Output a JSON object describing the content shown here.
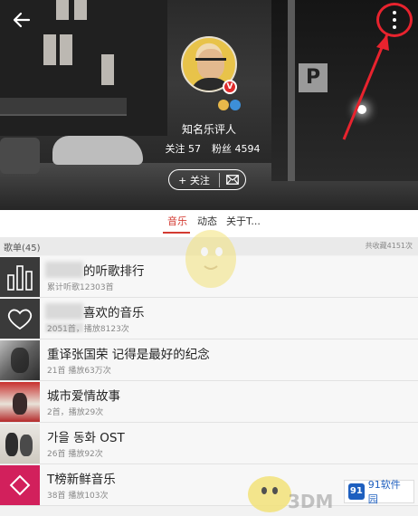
{
  "colors": {
    "accent": "#d33a31",
    "highlight": "#e8232e"
  },
  "header": {
    "back_icon": "arrow-left-icon",
    "more_icon": "more-vertical-icon",
    "profile_title": "知名乐评人",
    "stats": {
      "follow": "关注 57",
      "fans": "粉丝 4594"
    },
    "follow_label": "+ 关注",
    "message_icon": "mail-icon",
    "verified_badge": "V"
  },
  "tabs": [
    {
      "label": "音乐",
      "active": true
    },
    {
      "label": "动态",
      "active": false
    },
    {
      "label": "关于T...",
      "active": false
    }
  ],
  "section": {
    "title": "歌单(45)",
    "meta": "共收藏4151次"
  },
  "playlists": [
    {
      "title": "的听歌排行",
      "subtitle": "累计听歌12303首",
      "cover": "bar-chart-icon"
    },
    {
      "title": "喜欢的音乐",
      "subtitle": "2051首，播放8123次",
      "cover": "heart-icon"
    },
    {
      "title": "重译张国荣 记得是最好的纪念",
      "subtitle": "21首  播放63万次",
      "cover": "photo"
    },
    {
      "title": "城市爱情故事",
      "subtitle": "2首，播放29次",
      "cover": "photo"
    },
    {
      "title": "가을 동화 OST",
      "subtitle": "26首  播放92次",
      "cover": "photo"
    },
    {
      "title": "T榜新鲜音乐",
      "subtitle": "38首  播放103次",
      "cover": "photo"
    }
  ],
  "watermarks": {
    "brand": "3DM",
    "site": "91软件园",
    "site_logo": "91"
  }
}
